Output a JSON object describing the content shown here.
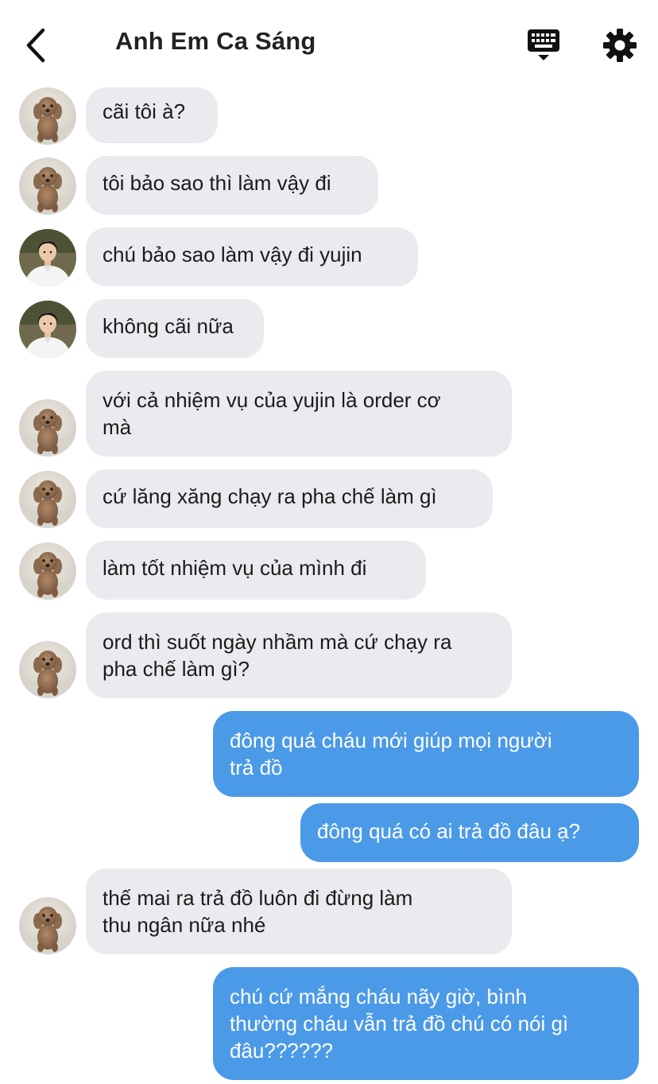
{
  "header": {
    "title": "Anh Em Ca Sáng",
    "back_icon": "chevron-left-icon",
    "keyboard_icon": "keyboard-icon",
    "settings_icon": "gear-icon"
  },
  "colors": {
    "incoming_bubble": "#e9ebef",
    "outgoing_bubble": "#4b9ae7",
    "outgoing_text": "#ffffff"
  },
  "messages": [
    {
      "direction": "in",
      "avatar": "poodle-avatar",
      "text": "cãi tôi à?"
    },
    {
      "direction": "in",
      "avatar": "poodle-avatar",
      "text": "tôi bảo sao thì làm vậy đi"
    },
    {
      "direction": "in",
      "avatar": "person-avatar",
      "text": "chú bảo sao làm vậy đi yujin"
    },
    {
      "direction": "in",
      "avatar": "person-avatar",
      "text": "không cãi nữa"
    },
    {
      "direction": "in",
      "avatar": "poodle-avatar",
      "text": "với cả nhiệm vụ của yujin là order cơ\nmà"
    },
    {
      "direction": "in",
      "avatar": "poodle-avatar",
      "text": "cứ lăng xăng chạy ra pha chế làm gì"
    },
    {
      "direction": "in",
      "avatar": "poodle-avatar",
      "text": "làm tốt nhiệm vụ của mình đi"
    },
    {
      "direction": "in",
      "avatar": "poodle-avatar",
      "text": "ord thì suốt ngày nhầm mà cứ chạy ra\npha chế làm gì?"
    },
    {
      "direction": "out",
      "text": "đông quá cháu mới giúp mọi người\ntrả đồ"
    },
    {
      "direction": "out",
      "text": "đông quá có ai trả đồ đâu ạ?"
    },
    {
      "direction": "in",
      "avatar": "poodle-avatar",
      "text": "thế mai ra trả đồ luôn đi đừng làm\nthu ngân nữa nhé"
    },
    {
      "direction": "out",
      "text": "chú cứ mắng cháu nãy giờ, bình\nthường cháu vẫn trả đồ chú có nói gì\nđâu??????"
    }
  ]
}
